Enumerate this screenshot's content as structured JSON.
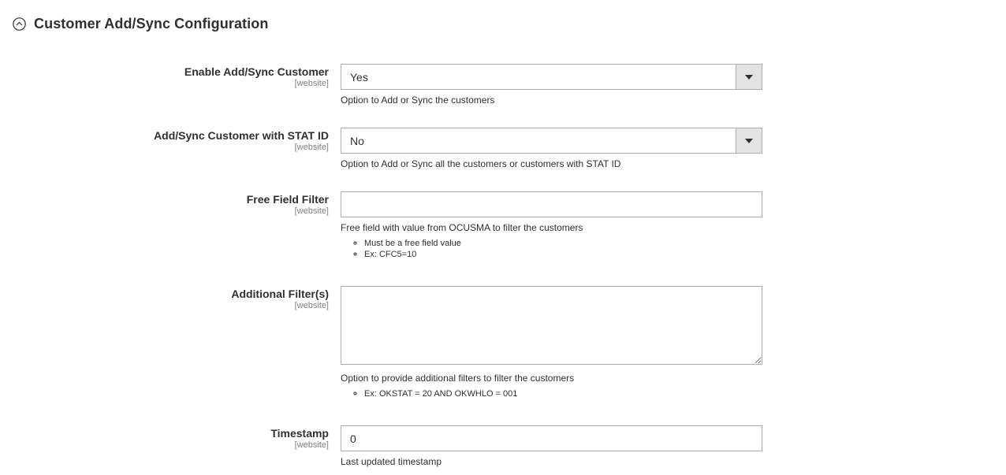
{
  "section": {
    "title": "Customer Add/Sync Configuration",
    "icon": "collapse-circle-up-icon"
  },
  "fields": {
    "enable_sync": {
      "label": "Enable Add/Sync Customer",
      "scope": "[website]",
      "value": "Yes",
      "note": "Option to Add or Sync the customers"
    },
    "sync_stat_id": {
      "label": "Add/Sync Customer with STAT ID",
      "scope": "[website]",
      "value": "No",
      "note": "Option to Add or Sync all the customers or customers with STAT ID"
    },
    "free_field_filter": {
      "label": "Free Field Filter",
      "scope": "[website]",
      "value": "",
      "note": "Free field with value from OCUSMA to filter the customers",
      "hints": [
        "Must be a free field value",
        "Ex: CFC5=10"
      ]
    },
    "additional_filters": {
      "label": "Additional Filter(s)",
      "scope": "[website]",
      "value": "",
      "note": "Option to provide additional filters to filter the customers",
      "hints": [
        "Ex: OKSTAT = 20 AND OKWHLO = 001"
      ]
    },
    "timestamp": {
      "label": "Timestamp",
      "scope": "[website]",
      "value": "0",
      "note": "Last updated timestamp"
    }
  }
}
